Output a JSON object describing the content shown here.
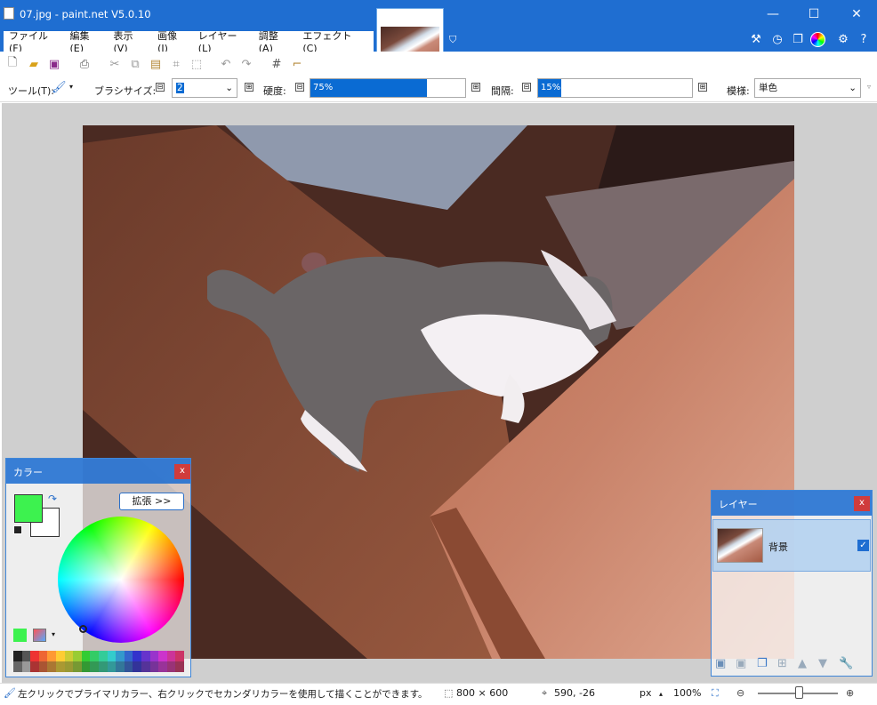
{
  "window": {
    "title": "07.jpg - paint.net V5.0.10",
    "minimize": "—",
    "maximize": "☐",
    "close": "✕"
  },
  "menu": [
    "ファイル(F)",
    "編集(E)",
    "表示(V)",
    "画像(I)",
    "レイヤー(L)",
    "調整(A)",
    "エフェクト(C)"
  ],
  "toolbar": {
    "tool_label": "ツール(T):",
    "brush_size_label": "ブラシサイズ:",
    "brush_size_value": "2",
    "hardness_label": "硬度:",
    "hardness_value": "75%",
    "hardness_level": 0.75,
    "spacing_label": "間隔:",
    "spacing_value": "15%",
    "spacing_level": 0.15,
    "pattern_label": "模様:",
    "pattern_value": "単色",
    "minus": "⊟",
    "plus": "⊞"
  },
  "colors_panel": {
    "title": "カラー",
    "expand_button": "拡張 >>",
    "close": "x",
    "primary_color": "#3df24f",
    "secondary_color": "#ffffff"
  },
  "layers_panel": {
    "title": "レイヤー",
    "close": "x",
    "layers": [
      {
        "name": "背景",
        "visible": true
      }
    ]
  },
  "status": {
    "hint": "左クリックでプライマリカラー、右クリックでセカンダリカラーを使用して描くことができます。",
    "image_size": "800 × 600",
    "cursor_pos": "590, -26",
    "unit": "px",
    "zoom": "100%"
  },
  "icons": {
    "check": "✓"
  }
}
